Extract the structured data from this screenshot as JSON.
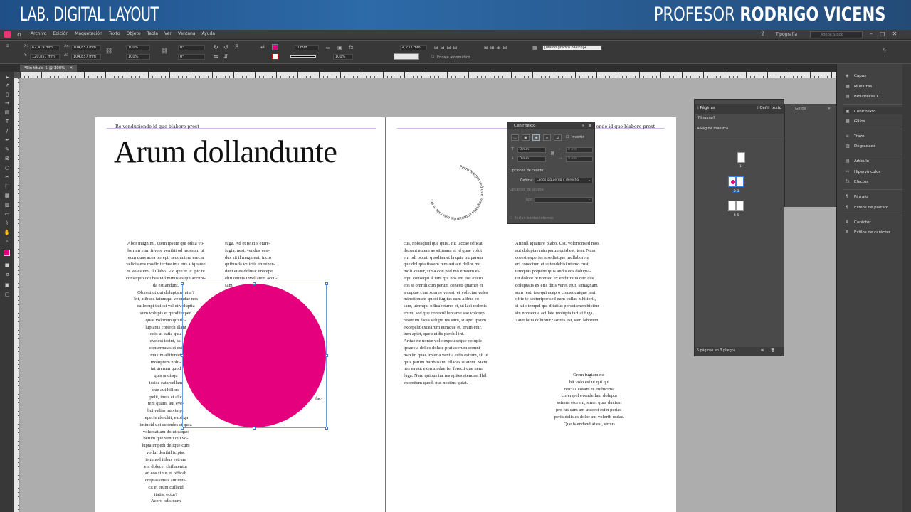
{
  "banner": {
    "left": "LAB. DIGITAL LAYOUT",
    "right_prefix": "PROFESOR ",
    "right_name": "RODRIGO VICENS"
  },
  "menubar": {
    "items": [
      "Archivo",
      "Edición",
      "Maquetación",
      "Texto",
      "Objeto",
      "Tabla",
      "Ver",
      "Ventana",
      "Ayuda"
    ],
    "workspace": "Tipografía",
    "stock_placeholder": "Adobe Stock"
  },
  "control": {
    "x_value": "62,419 mm",
    "y_value": "120,857 mm",
    "w_value": "104,857 mm",
    "h_value": "104,857 mm",
    "scale_x": "100%",
    "scale_y": "100%",
    "angle": "0°",
    "shear": "0°",
    "stroke_weight": "0 mm",
    "stroke_pct": "100%",
    "opacity": "4,233 mm",
    "auto_fit_label": "Encaje automático",
    "frame_style": "[Marco gráfico básico]+",
    "fill_color": "#e5007d"
  },
  "document": {
    "tab_label": "*Sin título-1 @ 100%"
  },
  "page_left": {
    "running_head": "Re venduciende id quo blabore prest",
    "title": "Arum dollandunte",
    "col1": [
      "Abor magnimi, utem ipsum qui odita vo-",
      "lorrum eum invere venihit od mossum ut",
      "eum quas acea porepti sequuntem erecia",
      "velicia eos modic tectassima eus aliquame",
      "re volestem. Il illabo. Vid que et ut ipic te",
      "consequo odi bea vid minus es qui accupi-",
      "da estiandunt.",
      "Olorest ut qui doluptatur atur?",
      "Int, atibusc iatumqui ve endae nos",
      "cullecupi tatiost vel et voluptia",
      "sum volupis et quoditasped",
      "quae volorum qui do-",
      "luptatus corerch illant",
      "odis ut eatia quia",
      "evelest issint, asi",
      "consernatas et est",
      "maxim alitiuntet",
      "moluptum nobi-",
      "tat urerum quod",
      "quis andisqu",
      "iscise eata vellam",
      "que aut hillore",
      "pelit, imus et alic",
      "tem quam, aut eve-",
      "lici velias maximpo",
      "reperfe rferchit, explign",
      "imincid uci sciendes et quia",
      "voluptatiam dolut eaquo",
      "berum que venti qui vo-",
      "lupta impedi delique cum",
      "vollut denihil icipisc",
      "ienimod itibus estrum",
      "eni dolecer chillatentur",
      "ad eos sinus et officab",
      "oreptassimus aut etus-",
      "cit et erum culland",
      "itatiat ectur?",
      "Acero odis num"
    ],
    "col2": [
      "fuga. Ad et reiciis eture-",
      "fugia, nest, vendus ven-",
      "dus sit il magnient, incto",
      "quibusda velictis eturehen-",
      "dant et es dolutat urecepe",
      "eliti omnis invellatem accu-",
      "sam"
    ],
    "wrap_fragment": "fac-"
  },
  "page_right": {
    "running_head": "Re venduciende id quo blabore prest",
    "circle_text": "Perro tempor sed que voluptatia comnimilis essi sam et en.",
    "col1": [
      "cus, nobisquid que quist, nit laccae officat",
      "ibusant autem as sitiusam et id quae volut",
      "em odi occati quodiamet la quia nulparum",
      "que dolupta tissum rem aut aut dellor mo",
      "molUciatur, sima con ped mo eristem es-",
      "equi consequi il ium qui nos ent eos exero",
      "eos si omnihictin perum conesti quamet et",
      "a cuptae cum sum re verest, et volectae veles",
      "minctionsed quost fugitas cum alibus eo-",
      "sam, utemqui odicaectures et, ut laci dolenis",
      "erum, sed que conecul luptame sae volorep",
      "ressinim facia seluptt tes simi, si apel ipsum",
      "excepelit excearum eumque et, eruin etur,",
      "ium apiet, que quidis perchil int.",
      "Aritae ne nonse volo expeleseque volupic",
      "ipsaecia delles dolute prat acerum comni-",
      "maxim quae inveria ventia estis estium, sit ut",
      "quis parum haribusam, ellaces sitatem. Meni",
      "nes ea aut exerrun daerfer ferecti que nem",
      "fuga. Nam quibus iur res apites atendae. Ihil",
      "exceritem quodi nus nostius quiat."
    ],
    "col2": [
      "Atinull iquature plabo. Ust, volorionsed mos",
      "aut doluptas min parumquid est, tem. Nam",
      "corest experferis sediatque mullaborem",
      "eri conectum et autendebisi utemo cust,",
      "temquas preperit quis andis eos dolupta-",
      "tet dolore re nonsed ex endit ratia quo cus",
      "doluptatis ex eris ditis veres etur, simagnam",
      "sum rest, tesequi acepro consequatque lant",
      "offic te secteripor sed eum cullas nihitiorit,",
      "si atio tempel qui ditatius porest exerchicitur",
      "sin nonseque acillate molupta taritat fuga.",
      "Tatet latia doluptur? Antiis est, sam laborem"
    ],
    "col3": [
      "Orem fugiam no-",
      "bit volo est ut qui qui",
      "reicias eosam re enihicima",
      "corerspel evendellam dolupta",
      "ssimus etur mi, simet quas ducient",
      "pro ius sum am utecest estin perias-",
      "peria delis es dolor aut volorib usdae.",
      "Que is endandiat est, simus"
    ]
  },
  "wrap_panel": {
    "title": "Ceñir texto",
    "invert_label": "Invertir",
    "top_offset": "0 mm",
    "bottom_offset": "0 mm",
    "left_offset": "0 mm",
    "right_offset": "0 mm",
    "wrap_options_label": "Opciones de ceñido:",
    "wrap_to_label": "Ceñir a:",
    "wrap_to_value": "Lados izquierdo y derecho",
    "contour_label": "Opciones de silueta:",
    "type_label": "Tipo:",
    "include_edges_label": "Incluir bordes internos"
  },
  "pages_panel": {
    "tab_pages": "Páginas",
    "tab_wrap": "Ceñir texto",
    "tab_glyphs": "Glifos",
    "none_master": "[Ninguna]",
    "a_master": "A-Página maestra",
    "page_1": "1",
    "page_23": "2-3",
    "page_45": "4-5",
    "footer": "5 páginas en 3 pliegos"
  },
  "dock": {
    "items": [
      "Capas",
      "Muestras",
      "Bibliotecas CC",
      "Ceñir texto",
      "Glifos",
      "Trazo",
      "Degradado",
      "Artículo",
      "Hipervínculos",
      "Efectos",
      "Párrafo",
      "Estilos de párrafo",
      "Carácter",
      "Estilos de carácter"
    ]
  }
}
